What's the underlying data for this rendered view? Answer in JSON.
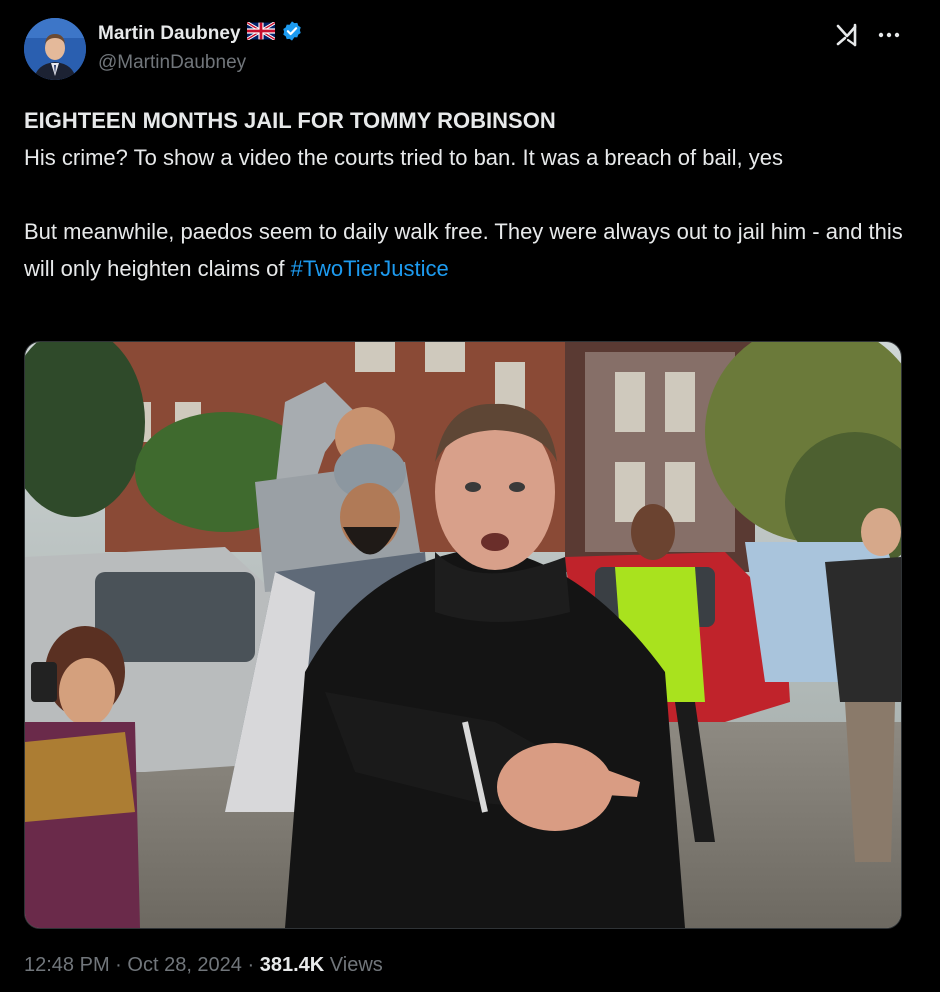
{
  "author": {
    "display_name": "Martin Daubney",
    "handle": "@MartinDaubney",
    "flag_icon": "uk-flag-icon",
    "verified_icon": "verified-badge-icon",
    "verified_color": "#1d9bf0"
  },
  "actions": {
    "grok_icon": "grok-icon",
    "more_icon": "more-options-icon"
  },
  "post": {
    "headline": "EIGHTEEN MONTHS JAIL FOR TOMMY ROBINSON",
    "paragraph1": "His crime? To show a video the courts tried to ban. It was a breach of bail, yes",
    "paragraph2_text": "But meanwhile, paedos seem to daily walk free. They were always out to jail him - and this will only heighten claims of ",
    "hashtag": "#TwoTierJustice",
    "hashtag_color": "#1d9bf0"
  },
  "meta": {
    "time": "12:48 PM",
    "separator": "·",
    "date": "Oct 28, 2024",
    "views_count": "381.4K",
    "views_label": "Views"
  },
  "colors": {
    "background": "#000000",
    "text_primary": "#e7e9ea",
    "text_secondary": "#71767b"
  }
}
